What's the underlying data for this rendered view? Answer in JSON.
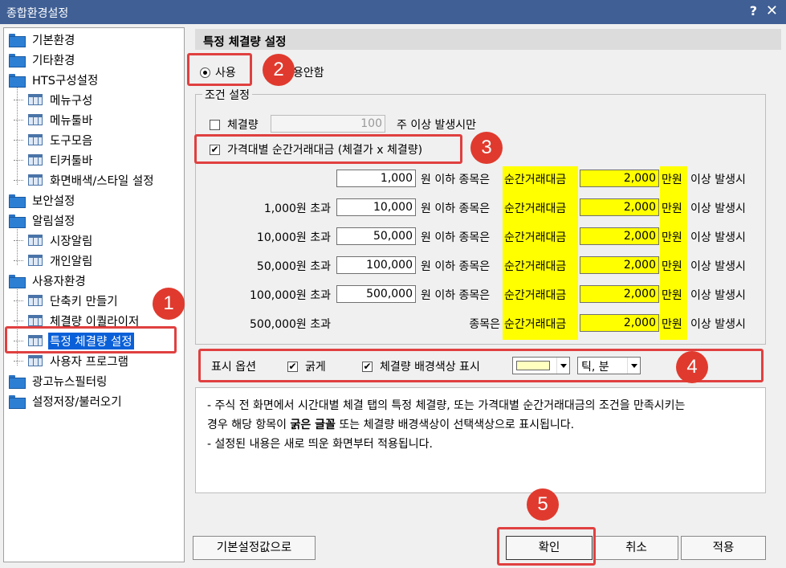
{
  "window": {
    "title": "종합환경설정",
    "help": "?",
    "close": "✕"
  },
  "tree": [
    {
      "label": "기본환경",
      "type": "folder"
    },
    {
      "label": "기타환경",
      "type": "folder"
    },
    {
      "label": "HTS구성설정",
      "type": "folder"
    },
    {
      "label": "메뉴구성",
      "type": "page"
    },
    {
      "label": "메뉴툴바",
      "type": "page"
    },
    {
      "label": "도구모음",
      "type": "page"
    },
    {
      "label": "티커툴바",
      "type": "page"
    },
    {
      "label": "화면배색/스타일 설정",
      "type": "page"
    },
    {
      "label": "보안설정",
      "type": "folder"
    },
    {
      "label": "알림설정",
      "type": "folder"
    },
    {
      "label": "시장알림",
      "type": "page"
    },
    {
      "label": "개인알림",
      "type": "page"
    },
    {
      "label": "사용자환경",
      "type": "folder"
    },
    {
      "label": "단축키 만들기",
      "type": "page"
    },
    {
      "label": "체결량 이퀄라이저",
      "type": "page"
    },
    {
      "label": "특정 체결량 설정",
      "type": "page",
      "selected": true
    },
    {
      "label": "사용자 프로그램",
      "type": "page"
    },
    {
      "label": "광고뉴스필터링",
      "type": "folder"
    },
    {
      "label": "설정저장/불러오기",
      "type": "folder"
    }
  ],
  "panel": {
    "header": "특정 체결량 설정",
    "use": "사용",
    "nouse": "용안함",
    "condition": "조건 설정",
    "volume_label": "체결량",
    "volume_value": "100",
    "volume_suffix": "주 이상 발생시만",
    "price_label": "가격대별 순간거래대금 (체결가 x 체결량)",
    "rows": [
      {
        "prefix": "",
        "upper": "1,000",
        "mid": "원 이하 종목은",
        "kw": "순간거래대금",
        "amount": "2,000",
        "unit": "만원",
        "suffix": "이상 발생시"
      },
      {
        "prefix": "1,000원 초과",
        "upper": "10,000",
        "mid": "원 이하 종목은",
        "kw": "순간거래대금",
        "amount": "2,000",
        "unit": "만원",
        "suffix": "이상 발생시"
      },
      {
        "prefix": "10,000원 초과",
        "upper": "50,000",
        "mid": "원 이하 종목은",
        "kw": "순간거래대금",
        "amount": "2,000",
        "unit": "만원",
        "suffix": "이상 발생시"
      },
      {
        "prefix": "50,000원 초과",
        "upper": "100,000",
        "mid": "원 이하 종목은",
        "kw": "순간거래대금",
        "amount": "2,000",
        "unit": "만원",
        "suffix": "이상 발생시"
      },
      {
        "prefix": "100,000원 초과",
        "upper": "500,000",
        "mid": "원 이하 종목은",
        "kw": "순간거래대금",
        "amount": "2,000",
        "unit": "만원",
        "suffix": "이상 발생시"
      },
      {
        "prefix": "500,000원 초과",
        "upper": "",
        "mid": "종목은",
        "kw": "순간거래대금",
        "amount": "2,000",
        "unit": "만원",
        "suffix": "이상 발생시"
      }
    ],
    "display_label": "표시 옵션",
    "bold_label": "굵게",
    "bg_label": "체결량 배경색상 표시",
    "color_value": "#ffffc0",
    "tick_select": "틱, 분",
    "note_line1": "- 주식 전 화면에서 시간대별 체결 탭의 특정 체결량, 또는 가격대별 순간거래대금의 조건을 만족시키는",
    "note_line2a": "경우 해당 항목이 ",
    "note_line2b": "굵은 글꼴",
    "note_line2c": " 또는 체결량 배경색상이 선택색상으로 표시됩니다.",
    "note_line3": "- 설정된 내용은 새로 띄운 화면부터 적용됩니다."
  },
  "buttons": {
    "defaults": "기본설정값으로",
    "ok": "확인",
    "cancel": "취소",
    "apply": "적용"
  },
  "badges": [
    "1",
    "2",
    "3",
    "4",
    "5"
  ]
}
